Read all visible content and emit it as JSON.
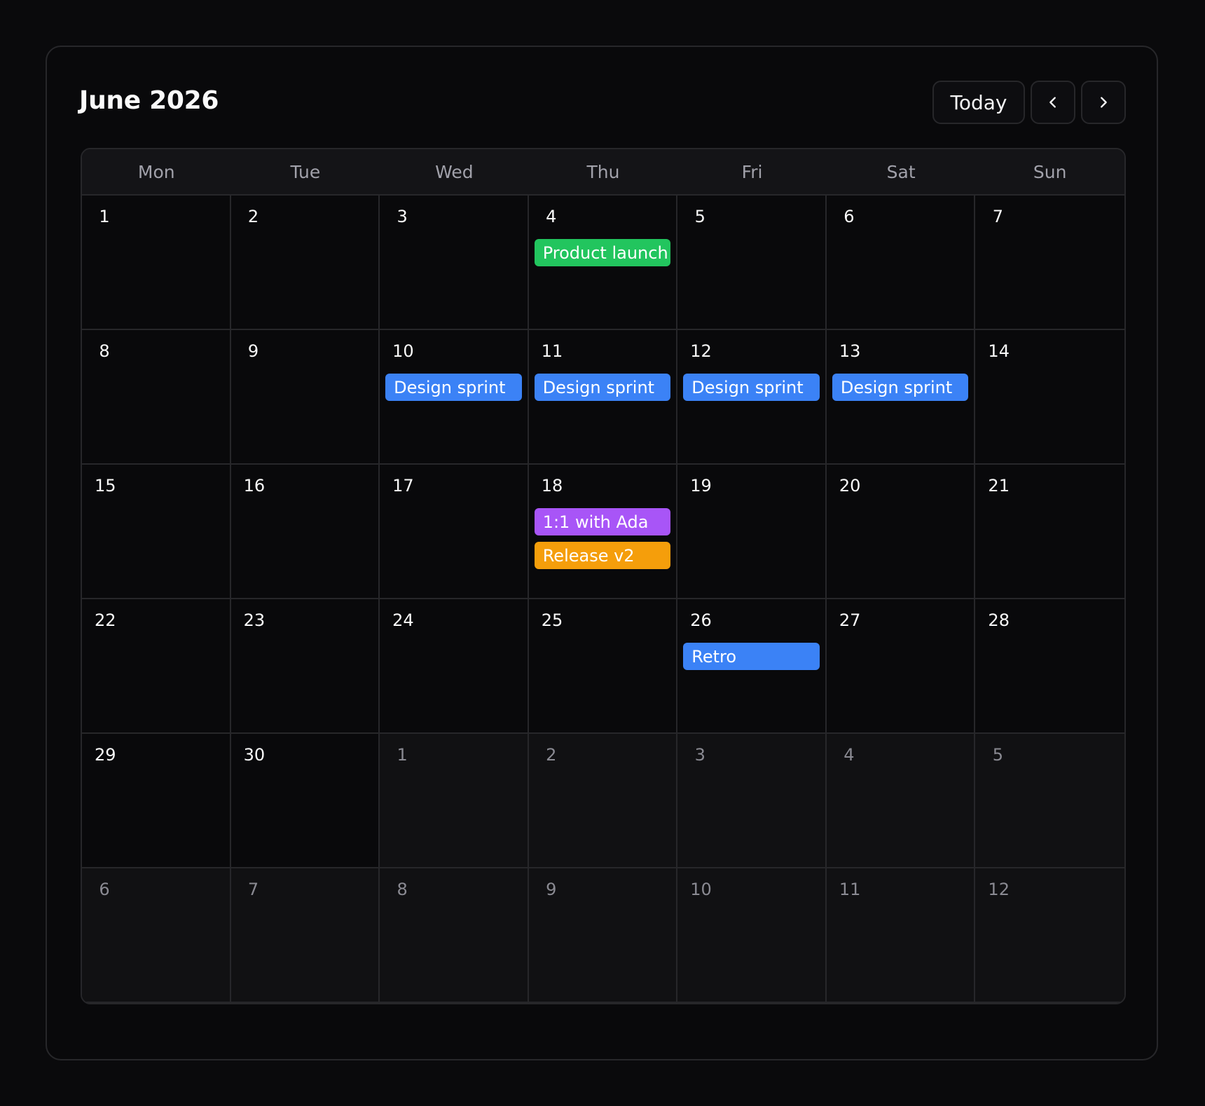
{
  "header": {
    "title": "June 2026",
    "today_label": "Today",
    "prev_icon": "chevron-left-icon",
    "next_icon": "chevron-right-icon"
  },
  "colors": {
    "blue": "#3b82f6",
    "green": "#22c55e",
    "purple": "#a855f7",
    "amber": "#f59e0b"
  },
  "weekdays": [
    "Mon",
    "Tue",
    "Wed",
    "Thu",
    "Fri",
    "Sat",
    "Sun"
  ],
  "days": [
    {
      "num": "1",
      "outside": false,
      "events": []
    },
    {
      "num": "2",
      "outside": false,
      "events": []
    },
    {
      "num": "3",
      "outside": false,
      "events": []
    },
    {
      "num": "4",
      "outside": false,
      "events": [
        {
          "title": "Product launch",
          "color": "green"
        }
      ]
    },
    {
      "num": "5",
      "outside": false,
      "events": []
    },
    {
      "num": "6",
      "outside": false,
      "events": []
    },
    {
      "num": "7",
      "outside": false,
      "events": []
    },
    {
      "num": "8",
      "outside": false,
      "events": []
    },
    {
      "num": "9",
      "outside": false,
      "events": []
    },
    {
      "num": "10",
      "outside": false,
      "events": [
        {
          "title": "Design sprint",
          "color": "blue"
        }
      ]
    },
    {
      "num": "11",
      "outside": false,
      "events": [
        {
          "title": "Design sprint",
          "color": "blue"
        }
      ]
    },
    {
      "num": "12",
      "outside": false,
      "events": [
        {
          "title": "Design sprint",
          "color": "blue"
        }
      ]
    },
    {
      "num": "13",
      "outside": false,
      "events": [
        {
          "title": "Design sprint",
          "color": "blue"
        }
      ]
    },
    {
      "num": "14",
      "outside": false,
      "events": []
    },
    {
      "num": "15",
      "outside": false,
      "events": []
    },
    {
      "num": "16",
      "outside": false,
      "events": []
    },
    {
      "num": "17",
      "outside": false,
      "events": []
    },
    {
      "num": "18",
      "outside": false,
      "events": [
        {
          "title": "1:1 with Ada",
          "color": "purple"
        },
        {
          "title": "Release v2",
          "color": "amber"
        }
      ]
    },
    {
      "num": "19",
      "outside": false,
      "events": []
    },
    {
      "num": "20",
      "outside": false,
      "events": []
    },
    {
      "num": "21",
      "outside": false,
      "events": []
    },
    {
      "num": "22",
      "outside": false,
      "events": []
    },
    {
      "num": "23",
      "outside": false,
      "events": []
    },
    {
      "num": "24",
      "outside": false,
      "events": []
    },
    {
      "num": "25",
      "outside": false,
      "events": []
    },
    {
      "num": "26",
      "outside": false,
      "events": [
        {
          "title": "Retro",
          "color": "blue"
        }
      ]
    },
    {
      "num": "27",
      "outside": false,
      "events": []
    },
    {
      "num": "28",
      "outside": false,
      "events": []
    },
    {
      "num": "29",
      "outside": false,
      "events": []
    },
    {
      "num": "30",
      "outside": false,
      "events": []
    },
    {
      "num": "1",
      "outside": true,
      "events": []
    },
    {
      "num": "2",
      "outside": true,
      "events": []
    },
    {
      "num": "3",
      "outside": true,
      "events": []
    },
    {
      "num": "4",
      "outside": true,
      "events": []
    },
    {
      "num": "5",
      "outside": true,
      "events": []
    },
    {
      "num": "6",
      "outside": true,
      "events": []
    },
    {
      "num": "7",
      "outside": true,
      "events": []
    },
    {
      "num": "8",
      "outside": true,
      "events": []
    },
    {
      "num": "9",
      "outside": true,
      "events": []
    },
    {
      "num": "10",
      "outside": true,
      "events": []
    },
    {
      "num": "11",
      "outside": true,
      "events": []
    },
    {
      "num": "12",
      "outside": true,
      "events": []
    }
  ]
}
